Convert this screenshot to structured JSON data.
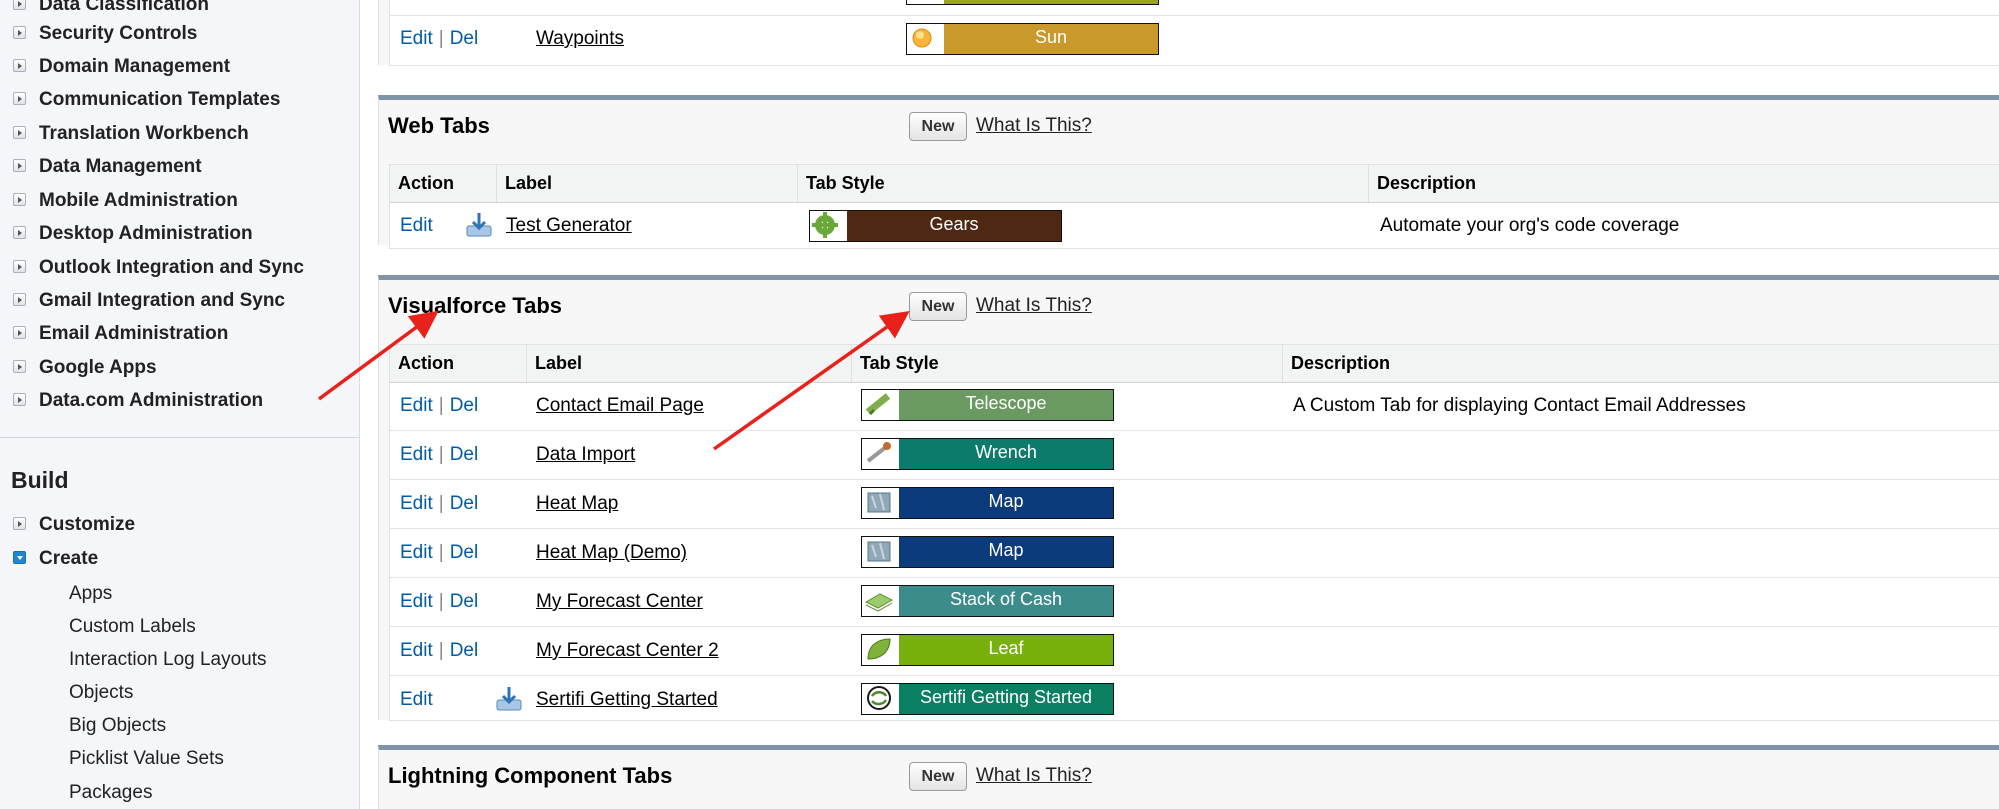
{
  "sidebar": {
    "items": [
      {
        "label": "Data Classification"
      },
      {
        "label": "Security Controls"
      },
      {
        "label": "Domain Management"
      },
      {
        "label": "Communication Templates"
      },
      {
        "label": "Translation Workbench"
      },
      {
        "label": "Data Management"
      },
      {
        "label": "Mobile Administration"
      },
      {
        "label": "Desktop Administration"
      },
      {
        "label": "Outlook Integration and Sync"
      },
      {
        "label": "Gmail Integration and Sync"
      },
      {
        "label": "Email Administration"
      },
      {
        "label": "Google Apps"
      },
      {
        "label": "Data.com Administration"
      }
    ],
    "build_heading": "Build",
    "build_items": [
      {
        "label": "Customize"
      },
      {
        "label": "Create"
      }
    ],
    "create_subitems": [
      {
        "label": "Apps"
      },
      {
        "label": "Custom Labels"
      },
      {
        "label": "Interaction Log Layouts"
      },
      {
        "label": "Objects"
      },
      {
        "label": "Big Objects"
      },
      {
        "label": "Picklist Value Sets"
      },
      {
        "label": "Packages"
      }
    ]
  },
  "top_section": {
    "rows": [
      {
        "edit": "Edit",
        "sep": "|",
        "del": "Del",
        "label": "Waypoints",
        "style": "Sun",
        "style_color": "#c9992c"
      }
    ]
  },
  "web_tabs": {
    "title": "Web Tabs",
    "new_label": "New",
    "what_label": "What Is This?",
    "headers": {
      "action": "Action",
      "label": "Label",
      "style": "Tab Style",
      "description": "Description"
    },
    "rows": [
      {
        "edit": "Edit",
        "label": "Test Generator",
        "style": "Gears",
        "style_color": "#4e2813",
        "description": "Automate your org's code coverage"
      }
    ]
  },
  "vf_tabs": {
    "title": "Visualforce Tabs",
    "new_label": "New",
    "what_label": "What Is This?",
    "headers": {
      "action": "Action",
      "label": "Label",
      "style": "Tab Style",
      "description": "Description"
    },
    "rows": [
      {
        "edit": "Edit",
        "sep": "|",
        "del": "Del",
        "label": "Contact Email Page",
        "style": "Telescope",
        "style_color": "#6a9a62",
        "description": "A Custom Tab for displaying Contact Email Addresses"
      },
      {
        "edit": "Edit",
        "sep": "|",
        "del": "Del",
        "label": "Data Import",
        "style": "Wrench",
        "style_color": "#0c7b6b",
        "description": ""
      },
      {
        "edit": "Edit",
        "sep": "|",
        "del": "Del",
        "label": "Heat Map",
        "style": "Map",
        "style_color": "#0b3b7a",
        "description": ""
      },
      {
        "edit": "Edit",
        "sep": "|",
        "del": "Del",
        "label": "Heat Map (Demo)",
        "style": "Map",
        "style_color": "#0b3b7a",
        "description": ""
      },
      {
        "edit": "Edit",
        "sep": "|",
        "del": "Del",
        "label": "My Forecast Center",
        "style": "Stack of Cash",
        "style_color": "#3d8c8c",
        "description": ""
      },
      {
        "edit": "Edit",
        "sep": "|",
        "del": "Del",
        "label": "My Forecast Center 2",
        "style": "Leaf",
        "style_color": "#79b10c",
        "description": ""
      },
      {
        "edit": "Edit",
        "label": "Sertifi Getting Started",
        "style": "Sertifi Getting Started",
        "style_color": "#0a7f62",
        "description": ""
      }
    ]
  },
  "lightning_tabs": {
    "title": "Lightning Component Tabs",
    "new_label": "New",
    "what_label": "What Is This?"
  },
  "colors": {
    "link": "#015ba7",
    "annotation_arrow": "#e8211b",
    "section_border": "#8094a8"
  }
}
